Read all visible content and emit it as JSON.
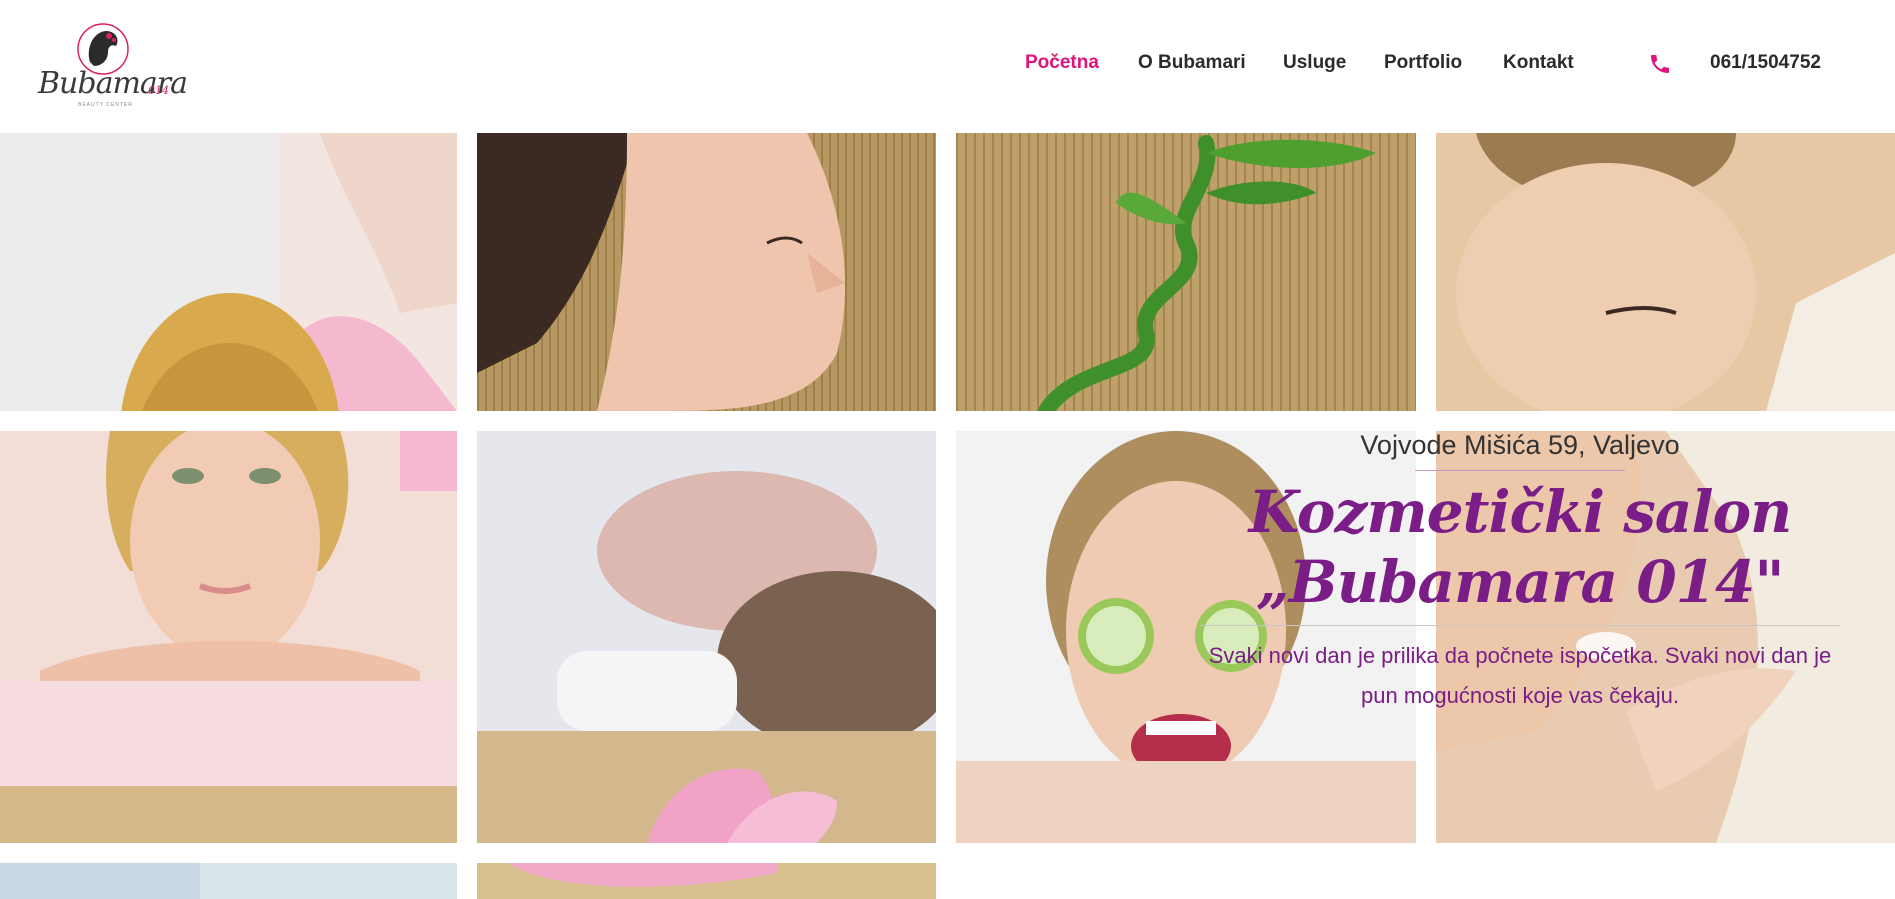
{
  "header": {
    "logo": {
      "wordmark": "Bubamara",
      "suffix": "014",
      "tagline": "BEAUTY CENTER"
    },
    "nav": [
      {
        "label": "Početna",
        "active": true
      },
      {
        "label": "O Bubamari",
        "active": false
      },
      {
        "label": "Usluge",
        "active": false
      },
      {
        "label": "Portfolio",
        "active": false
      },
      {
        "label": "Kontakt",
        "active": false
      }
    ],
    "phone": {
      "icon": "phone-icon",
      "number": "061/1504752"
    }
  },
  "hero": {
    "address": "Vojvode Mišića 59, Valjevo",
    "title": "Kozmetički salon „Bubamara 014\"",
    "subtitle": "Svaki novi dan je prilika da počnete ispočetka. Svaki novi dan je pun mogućnosti koje vas čekaju."
  },
  "colors": {
    "accent": "#e0137a",
    "title": "#7a1d86",
    "text": "#2b2b2b"
  }
}
